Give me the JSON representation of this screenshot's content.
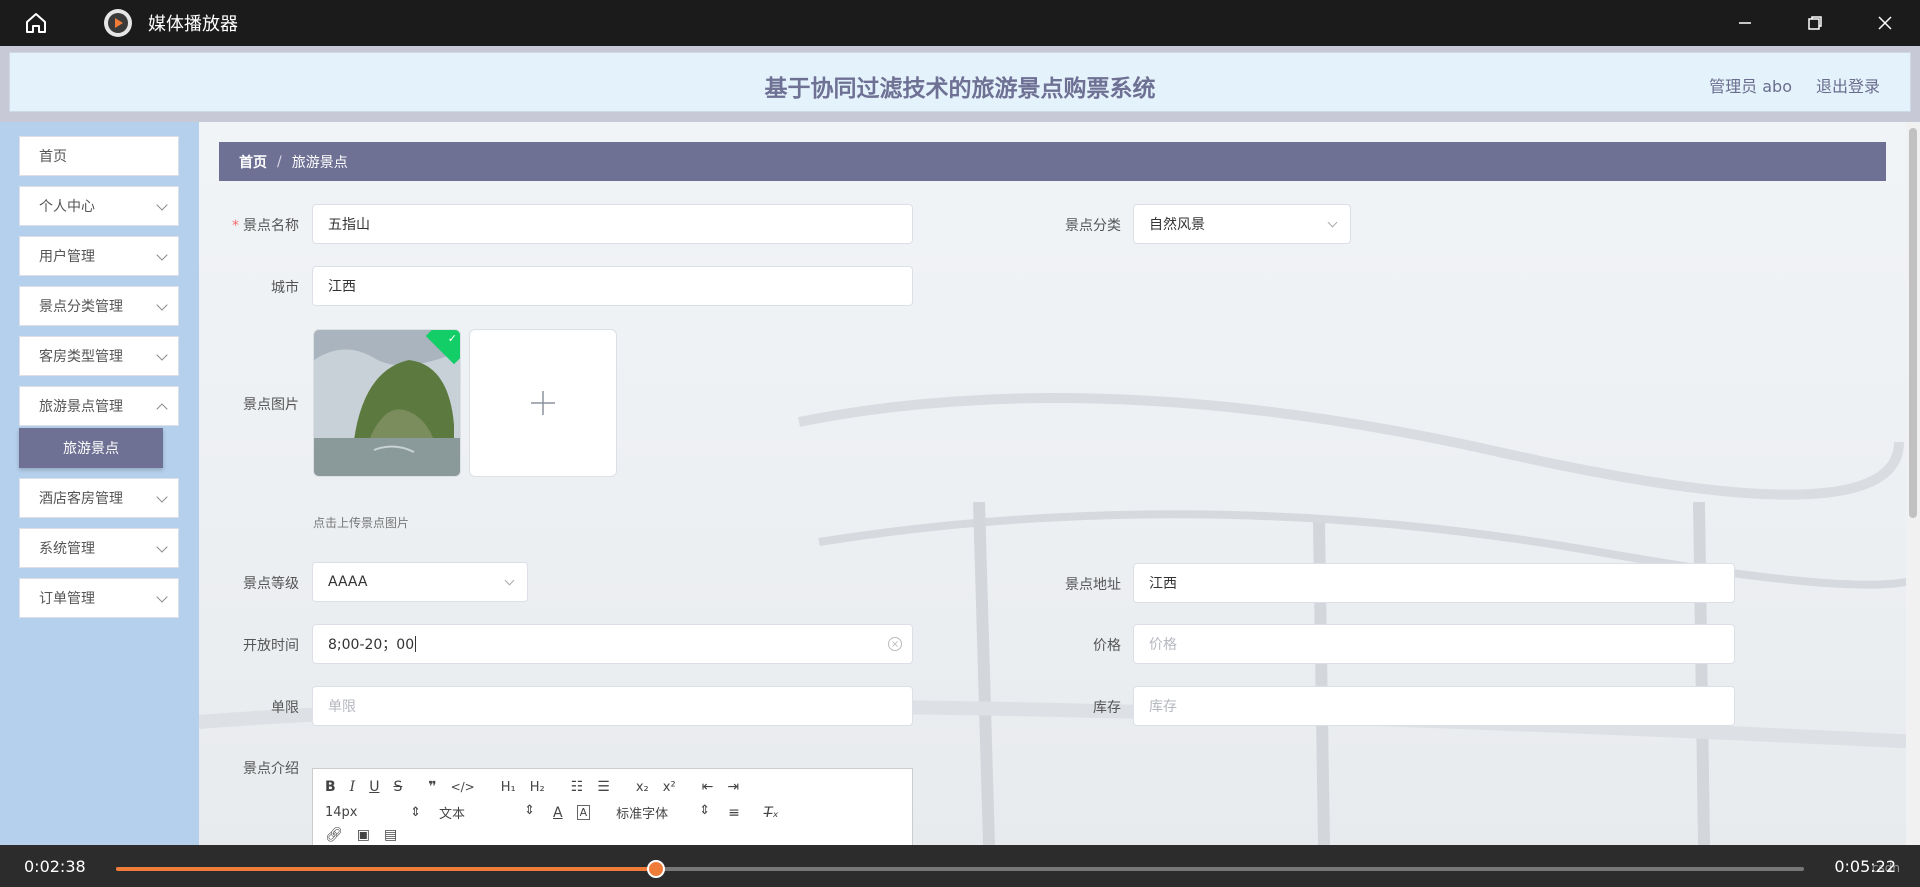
{
  "window": {
    "title": "媒体播放器"
  },
  "header": {
    "app_title": "基于协同过滤技术的旅游景点购票系统",
    "user_label": "管理员 abo",
    "logout_label": "退出登录"
  },
  "sidebar": {
    "items": [
      {
        "label": "首页"
      },
      {
        "label": "个人中心"
      },
      {
        "label": "用户管理"
      },
      {
        "label": "景点分类管理"
      },
      {
        "label": "客房类型管理"
      },
      {
        "label": "旅游景点管理"
      },
      {
        "label": "酒店客房管理"
      },
      {
        "label": "系统管理"
      },
      {
        "label": "订单管理"
      }
    ],
    "active_sub": "旅游景点"
  },
  "breadcrumb": {
    "home": "首页",
    "separator": "/",
    "current": "旅游景点"
  },
  "form": {
    "name": {
      "label": "景点名称",
      "value": "五指山"
    },
    "category": {
      "label": "景点分类",
      "value": "自然风景"
    },
    "city": {
      "label": "城市",
      "value": "江西"
    },
    "image": {
      "label": "景点图片",
      "hint": "点击上传景点图片"
    },
    "level": {
      "label": "景点等级",
      "value": "AAAA"
    },
    "address": {
      "label": "景点地址",
      "value": "江西"
    },
    "open_time": {
      "label": "开放时间",
      "value": "8;00-20；00"
    },
    "price": {
      "label": "价格",
      "placeholder": "价格"
    },
    "limit": {
      "label": "单限",
      "placeholder": "单限"
    },
    "stock": {
      "label": "库存",
      "placeholder": "库存"
    },
    "intro": {
      "label": "景点介绍"
    }
  },
  "editor": {
    "font_size": "14px",
    "block_type": "文本",
    "font_family": "标准字体"
  },
  "player": {
    "current_time": "0:02:38",
    "total_time": "0:05:22",
    "progress_fraction": 0.32,
    "watermark": "csdn"
  },
  "colors": {
    "accent": "#6e7094",
    "progress": "#f07c3a",
    "success": "#13ce66"
  }
}
